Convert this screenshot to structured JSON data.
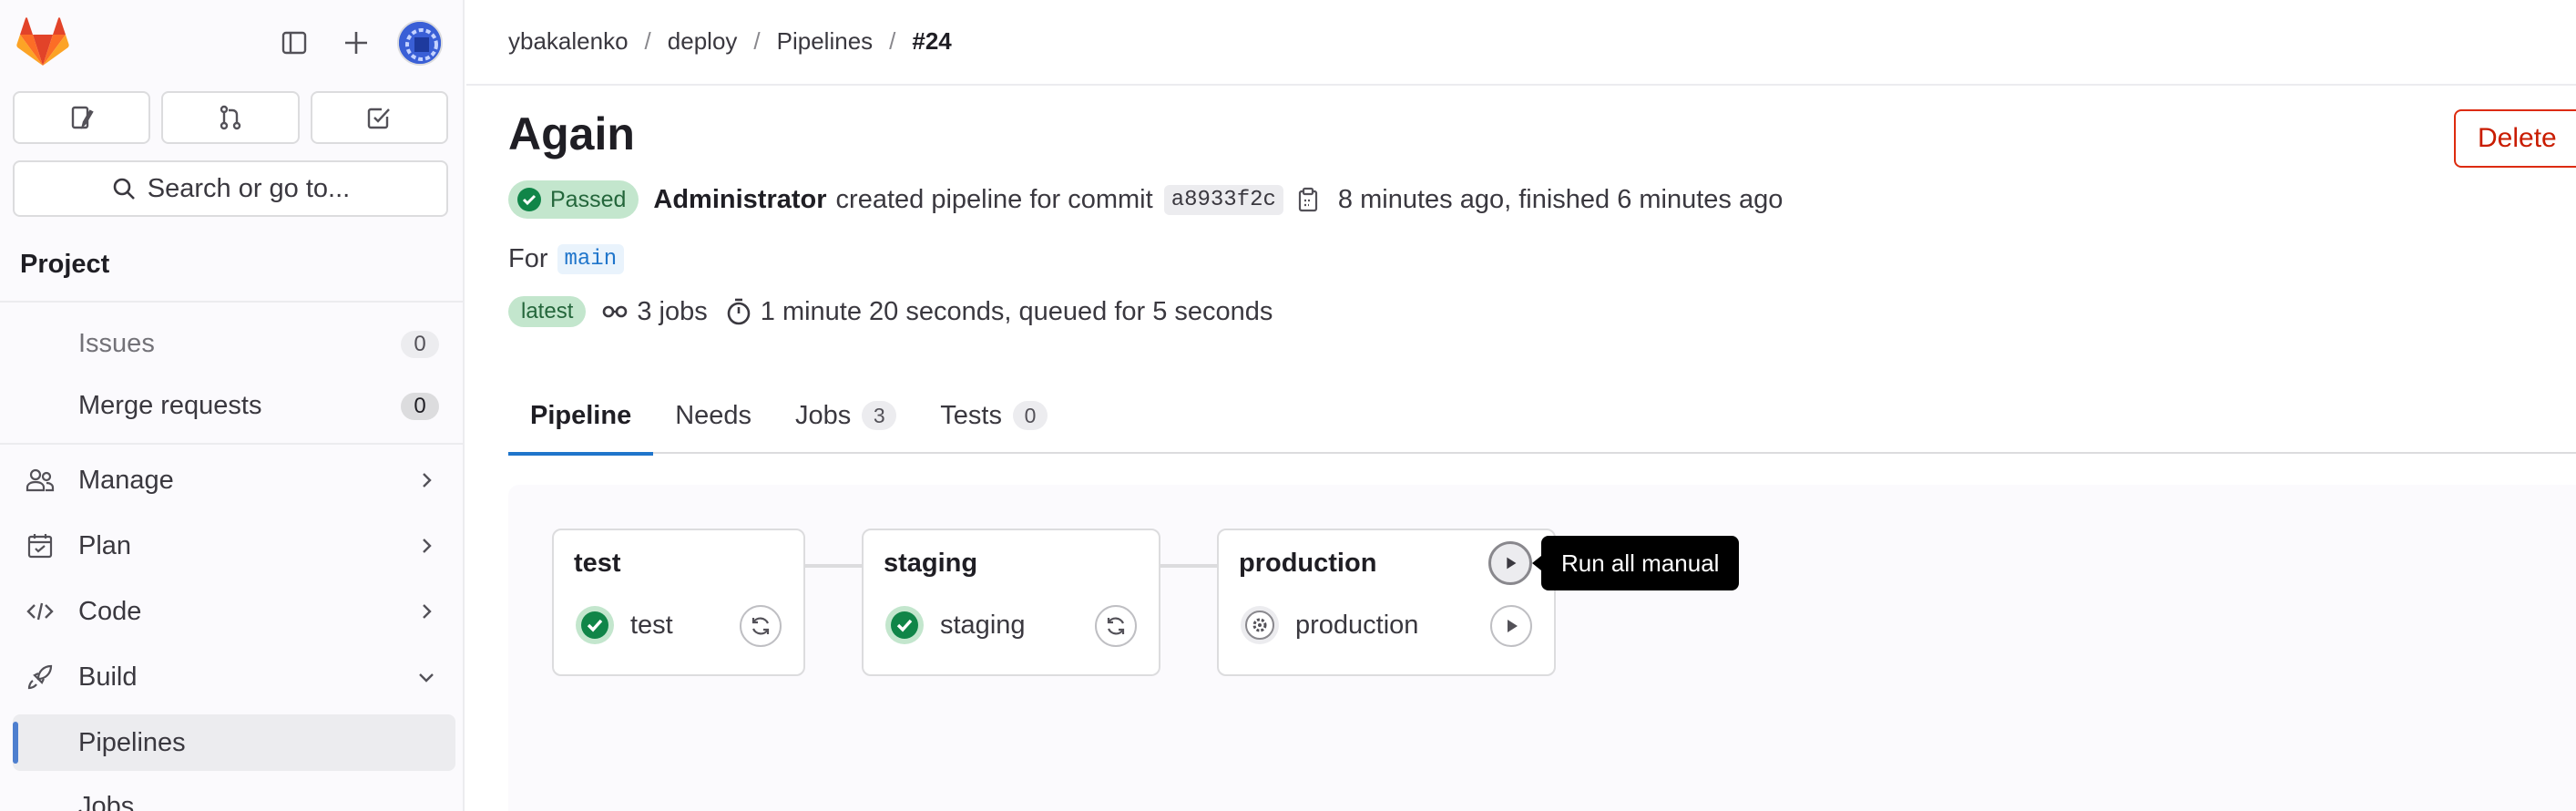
{
  "sidebar": {
    "search_label": "Search or go to...",
    "section_title": "Project",
    "items": [
      {
        "label": "Issues",
        "count": "0"
      },
      {
        "label": "Merge requests",
        "count": "0"
      },
      {
        "label": "Manage"
      },
      {
        "label": "Plan"
      },
      {
        "label": "Code"
      },
      {
        "label": "Build"
      },
      {
        "label": "Pipelines"
      },
      {
        "label": "Jobs"
      }
    ]
  },
  "breadcrumb": [
    "ybakalenko",
    "deploy",
    "Pipelines",
    "#24"
  ],
  "page": {
    "title": "Again",
    "delete_label": "Delete",
    "status": "Passed",
    "author": "Administrator",
    "created_text": "created pipeline for commit",
    "commit_sha": "a8933f2c",
    "time_text": "8 minutes ago, finished 6 minutes ago",
    "for_label": "For",
    "ref": "main",
    "latest_label": "latest",
    "jobs_text": "3 jobs",
    "duration_text": "1 minute 20 seconds, queued for 5 seconds"
  },
  "tabs": [
    {
      "label": "Pipeline"
    },
    {
      "label": "Needs"
    },
    {
      "label": "Jobs",
      "count": "3"
    },
    {
      "label": "Tests",
      "count": "0"
    }
  ],
  "stages": [
    {
      "name": "test",
      "job": "test",
      "status": "success",
      "action": "retry-icon"
    },
    {
      "name": "staging",
      "job": "staging",
      "status": "success",
      "action": "retry-icon"
    },
    {
      "name": "production",
      "job": "production",
      "status": "manual",
      "action": "play-icon"
    }
  ],
  "tooltip": "Run all manual",
  "colors": {
    "success": "#108548",
    "success_bg": "#c3e6cd",
    "danger": "#dd2b0e",
    "link": "#1f75cb",
    "active_accent": "#4e7fcf"
  }
}
